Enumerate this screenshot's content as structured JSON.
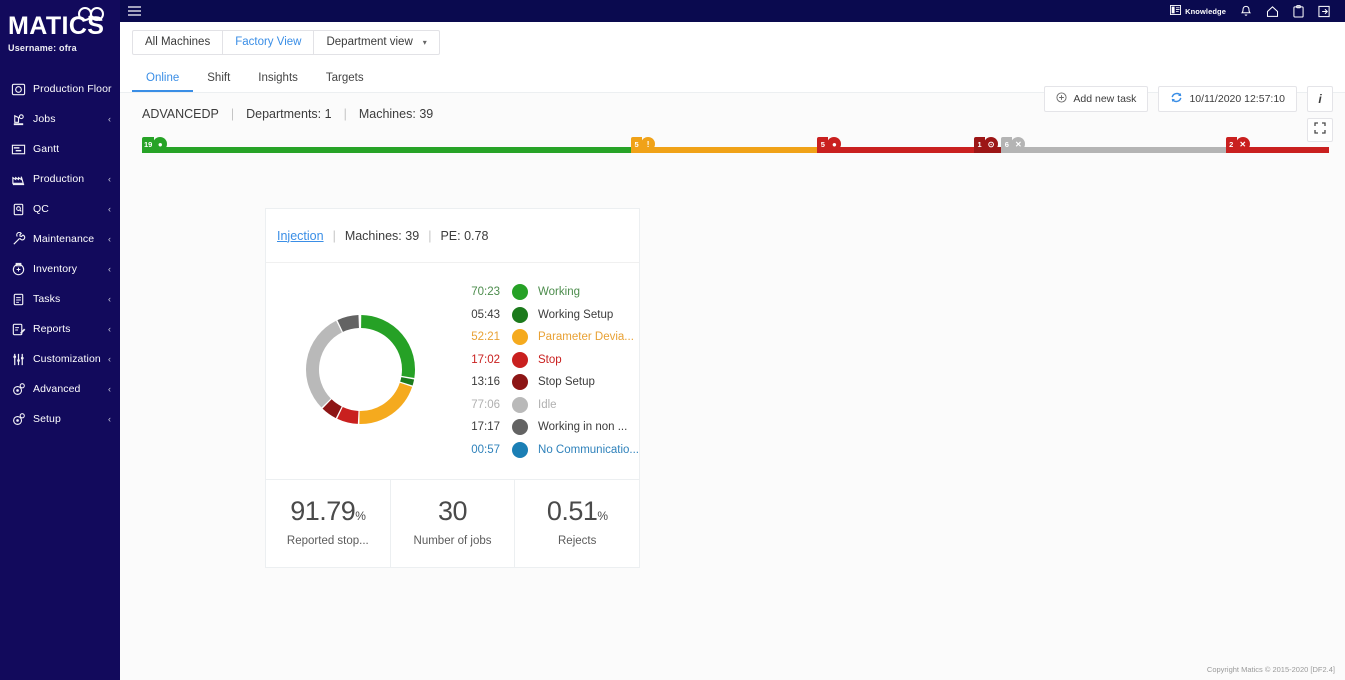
{
  "brand": {
    "title": "MATICS",
    "username": "Username: ofra",
    "logo_icon": "matics-glasses-logo"
  },
  "sidebar": {
    "items": [
      {
        "label": "Production Floor",
        "icon": "production-floor-icon",
        "caret": ""
      },
      {
        "label": "Jobs",
        "icon": "jobs-icon",
        "caret": "‹"
      },
      {
        "label": "Gantt",
        "icon": "gantt-icon",
        "caret": ""
      },
      {
        "label": "Production",
        "icon": "production-icon",
        "caret": "‹"
      },
      {
        "label": "QC",
        "icon": "qc-icon",
        "caret": "‹"
      },
      {
        "label": "Maintenance",
        "icon": "maintenance-icon",
        "caret": "‹"
      },
      {
        "label": "Inventory",
        "icon": "inventory-icon",
        "caret": "‹"
      },
      {
        "label": "Tasks",
        "icon": "tasks-icon",
        "caret": "‹"
      },
      {
        "label": "Reports",
        "icon": "reports-icon",
        "caret": "‹"
      },
      {
        "label": "Customization",
        "icon": "customization-icon",
        "caret": "‹"
      },
      {
        "label": "Advanced",
        "icon": "advanced-icon",
        "caret": "‹"
      },
      {
        "label": "Setup",
        "icon": "setup-icon",
        "caret": "‹"
      }
    ]
  },
  "topbar": {
    "menu_icon": "hamburger-menu-icon",
    "knowledge_label": "Knowledge",
    "knowledge_icon": "book-icon",
    "icons": [
      "bell-icon",
      "home-icon",
      "clipboard-icon",
      "logout-icon"
    ],
    "background": "#0a0a4f"
  },
  "viewbar": {
    "segments": [
      {
        "label": "All Machines",
        "active": false,
        "link": false
      },
      {
        "label": "Factory View",
        "active": false,
        "link": true
      },
      {
        "label": "Department view",
        "active": false,
        "link": false,
        "caret": "▾"
      }
    ]
  },
  "tabs": [
    {
      "label": "Online",
      "active": true
    },
    {
      "label": "Shift",
      "active": false
    },
    {
      "label": "Insights",
      "active": false
    },
    {
      "label": "Targets",
      "active": false
    }
  ],
  "actions": {
    "add_task_label": "Add new task",
    "add_task_icon": "plus-circle-icon",
    "refresh_icon": "refresh-icon",
    "timestamp": "10/11/2020 12:57:10",
    "info_label": "i",
    "expand_icon": "expand-icon"
  },
  "info": {
    "plant": "ADVANCEDP",
    "departments_label": "Departments:",
    "departments_value": "1",
    "machines_label": "Machines:",
    "machines_value": "39",
    "separator": "|"
  },
  "status_bar": {
    "segments": [
      {
        "name": "working",
        "count": "19",
        "color": "#27a327",
        "glyph": "●",
        "width_pct": 41.2
      },
      {
        "name": "parameter-dev",
        "count": "5",
        "color": "#f0a218",
        "glyph": "!",
        "width_pct": 15.7
      },
      {
        "name": "stop",
        "count": "5",
        "color": "#c9201f",
        "glyph": "●",
        "width_pct": 13.2
      },
      {
        "name": "stop-setup",
        "count": "1",
        "color": "#9c1616",
        "glyph": "⊙",
        "width_pct": 2.3
      },
      {
        "name": "idle",
        "count": "6",
        "color": "#b4b4b4",
        "glyph": "✕",
        "width_pct": 18.9
      },
      {
        "name": "no-comm",
        "count": "2",
        "color": "#c9201f",
        "glyph": "✕",
        "width_pct": 8.7
      }
    ]
  },
  "card": {
    "title_link": "Injection ",
    "machines_label": "Machines:",
    "machines_value": "39",
    "pe_label": "PE:",
    "pe_value": "0.78",
    "separator": "|",
    "stats": [
      {
        "value": "91.79",
        "unit": "%",
        "label": "Reported stop..."
      },
      {
        "value": "30",
        "unit": "",
        "label": "Number of jobs"
      },
      {
        "value": "0.51",
        "unit": "%",
        "label": "Rejects"
      }
    ]
  },
  "chart_data": {
    "type": "pie",
    "title": "Injection machine states",
    "legend_position": "right",
    "categories": [
      "Working",
      "Working Setup",
      "Parameter Devia...",
      "Stop",
      "Stop Setup",
      "Idle",
      "Working in non ...",
      "No Communicatio..."
    ],
    "value_labels": [
      "70:23",
      "05:43",
      "52:21",
      "17:02",
      "13:16",
      "77:06",
      "17:17",
      "00:57"
    ],
    "values": [
      70.383,
      5.716,
      52.35,
      17.033,
      13.266,
      77.1,
      17.283,
      0.95
    ],
    "colors": [
      "#26a126",
      "#1c7a1c",
      "#f5aa1e",
      "#c9201f",
      "#8d1515",
      "#b9b9b9",
      "#636363",
      "#1b7fb5"
    ],
    "text_colors": [
      "#4c8c4c",
      "#3c3c3c",
      "#e8a134",
      "#c9201f",
      "#3c3c3c",
      "#b0b0b0",
      "#3c3c3c",
      "#2f82bb"
    ],
    "units": "mm:ss"
  },
  "footer": {
    "copyright": "Copyright Matics © 2015-2020 [DF2.4]"
  }
}
